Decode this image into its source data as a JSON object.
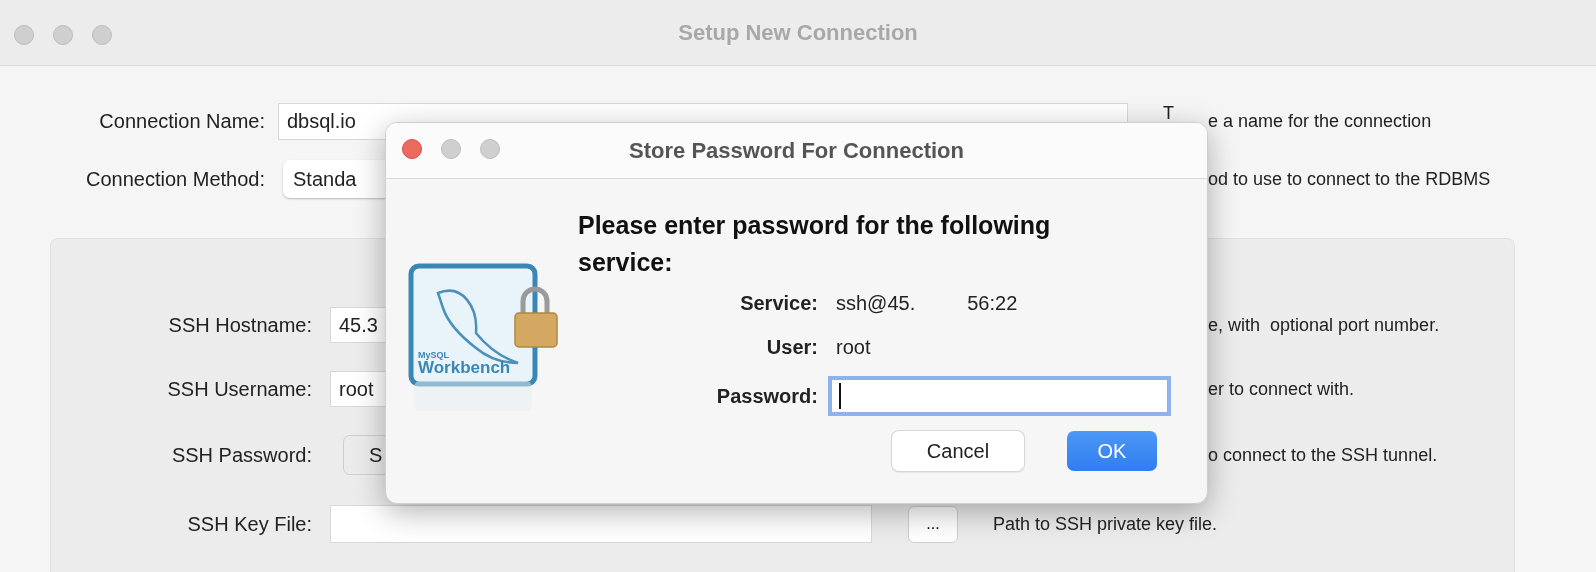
{
  "window": {
    "title": "Setup New Connection"
  },
  "connection": {
    "name_label": "Connection Name:",
    "name_value": "dbsql.io",
    "name_hint_start": "T",
    "name_hint": "e a name for the connection",
    "method_label": "Connection Method:",
    "method_value": "Standa",
    "method_hint": "od to use to connect to the RDBMS"
  },
  "ssh": {
    "rows": [
      {
        "kind": "field",
        "label": "SSH Hostname:",
        "value": "45.3",
        "hint": "e, with  optional port number."
      },
      {
        "kind": "field",
        "label": "SSH Username:",
        "value": "root",
        "hint": "er to connect with."
      },
      {
        "kind": "button",
        "label": "SSH Password:",
        "value": "S",
        "hint": "o connect to the SSH tunnel."
      },
      {
        "kind": "file",
        "label": "SSH Key File:",
        "value": "",
        "button": "...",
        "hint": "Path to SSH private key file."
      }
    ]
  },
  "dialog": {
    "title": "Store Password For Connection",
    "logo_small": "MySQL",
    "logo": "Workbench",
    "heading": "Please enter password for the following service:",
    "service_label": "Service:",
    "service_host": "ssh@45.",
    "service_port": "56:22",
    "user_label": "User:",
    "user_value": "root",
    "password_label": "Password:",
    "password_focused": true,
    "buttons": [
      {
        "label": "Cancel",
        "default": false
      },
      {
        "label": "OK",
        "default": true
      }
    ]
  }
}
